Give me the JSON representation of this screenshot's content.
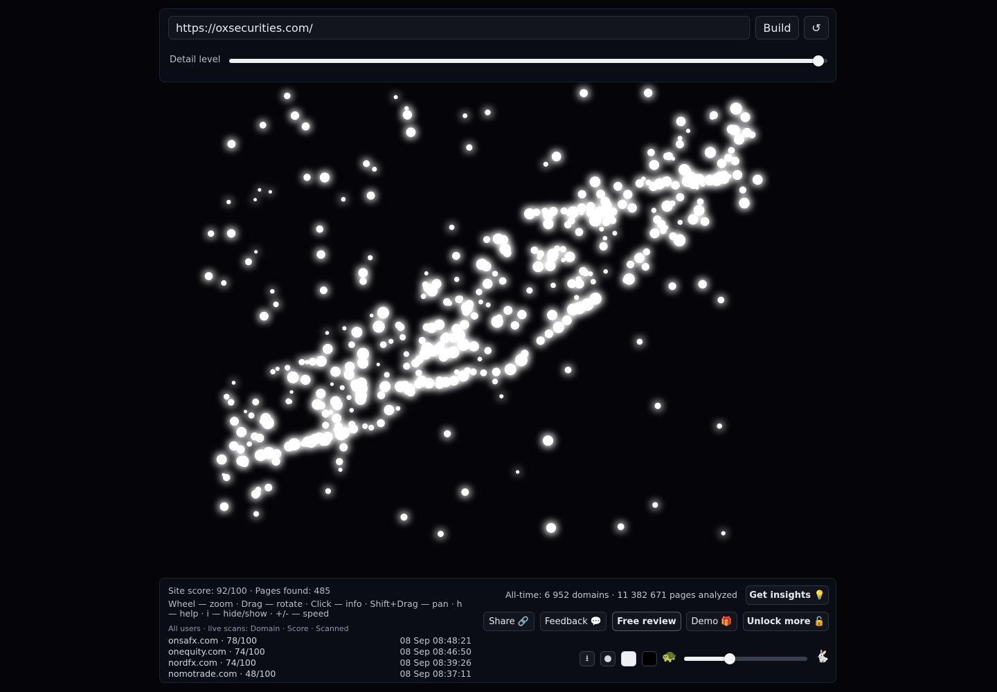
{
  "toolbar": {
    "url_value": "https://oxsecurities.com/",
    "build_label": "Build",
    "reset_label": "↺",
    "detail_label": "Detail level",
    "detail_level": 0.985
  },
  "graph": {
    "node_color": "#ffffff",
    "background": "#050509"
  },
  "stats": {
    "score_line": "Site score: 92/100 · Pages found: 485",
    "help_line": "Wheel — zoom · Drag — rotate · Click — info · Shift+Drag — pan · h — help · i — hide/show · +/- — speed",
    "scans_header": "All users · live scans: Domain · Score · Scanned",
    "scans": [
      {
        "domain": "onsafx.com · 78/100",
        "time": "08 Sep 08:48:21"
      },
      {
        "domain": "onequity.com · 74/100",
        "time": "08 Sep 08:46:50"
      },
      {
        "domain": "nordfx.com · 74/100",
        "time": "08 Sep 08:39:26"
      },
      {
        "domain": "nomotrade.com · 48/100",
        "time": "08 Sep 08:37:11"
      }
    ],
    "alltime_line": "All-time: 6 952 domains · 11 382 671 pages analyzed"
  },
  "actions": {
    "insights": "Get insights 💡",
    "share": "Share 🔗",
    "feedback": "Feedback 💬",
    "review": "Free review",
    "demo": "Demo 🎁",
    "unlock": "Unlock more 🔓"
  },
  "controls": {
    "export_icon": "⭳",
    "turtle_icon": "🐢",
    "rabbit_icon": "🐇",
    "speed_level": 0.37
  }
}
